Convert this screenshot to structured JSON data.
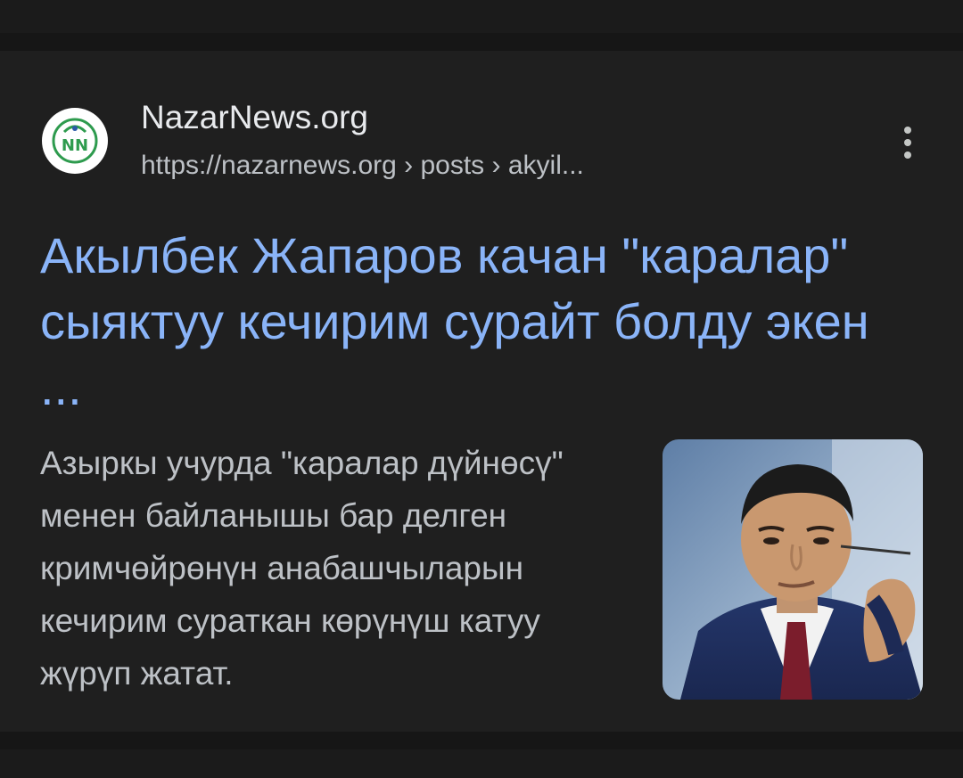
{
  "result": {
    "site_name": "NazarNews.org",
    "breadcrumb_url": "https://nazarnews.org › posts › akyil...",
    "logo_text": "NN",
    "headline": "Акылбек Жапаров качан \"каралар\" сыяктуу кечирим сурайт болду экен",
    "headline_ellipsis": "...",
    "snippet": "Азыркы учурда \"каралар дүйнөсү\" менен байланышы бар делген кримчөйрөнүн анабашчыларын кечирим сураткан көрүнүш катуу жүрүп жатат.",
    "more_icon": "kebab-vertical-icon",
    "thumbnail": "portrait-photo"
  },
  "colors": {
    "background": "#1f1f1f",
    "separator": "#161616",
    "title_link": "#8ab4f8",
    "site_name": "#e8eaed",
    "secondary_text": "#bdc1c6",
    "logo_green": "#2e9b4e",
    "logo_blue": "#2a5aa8"
  }
}
